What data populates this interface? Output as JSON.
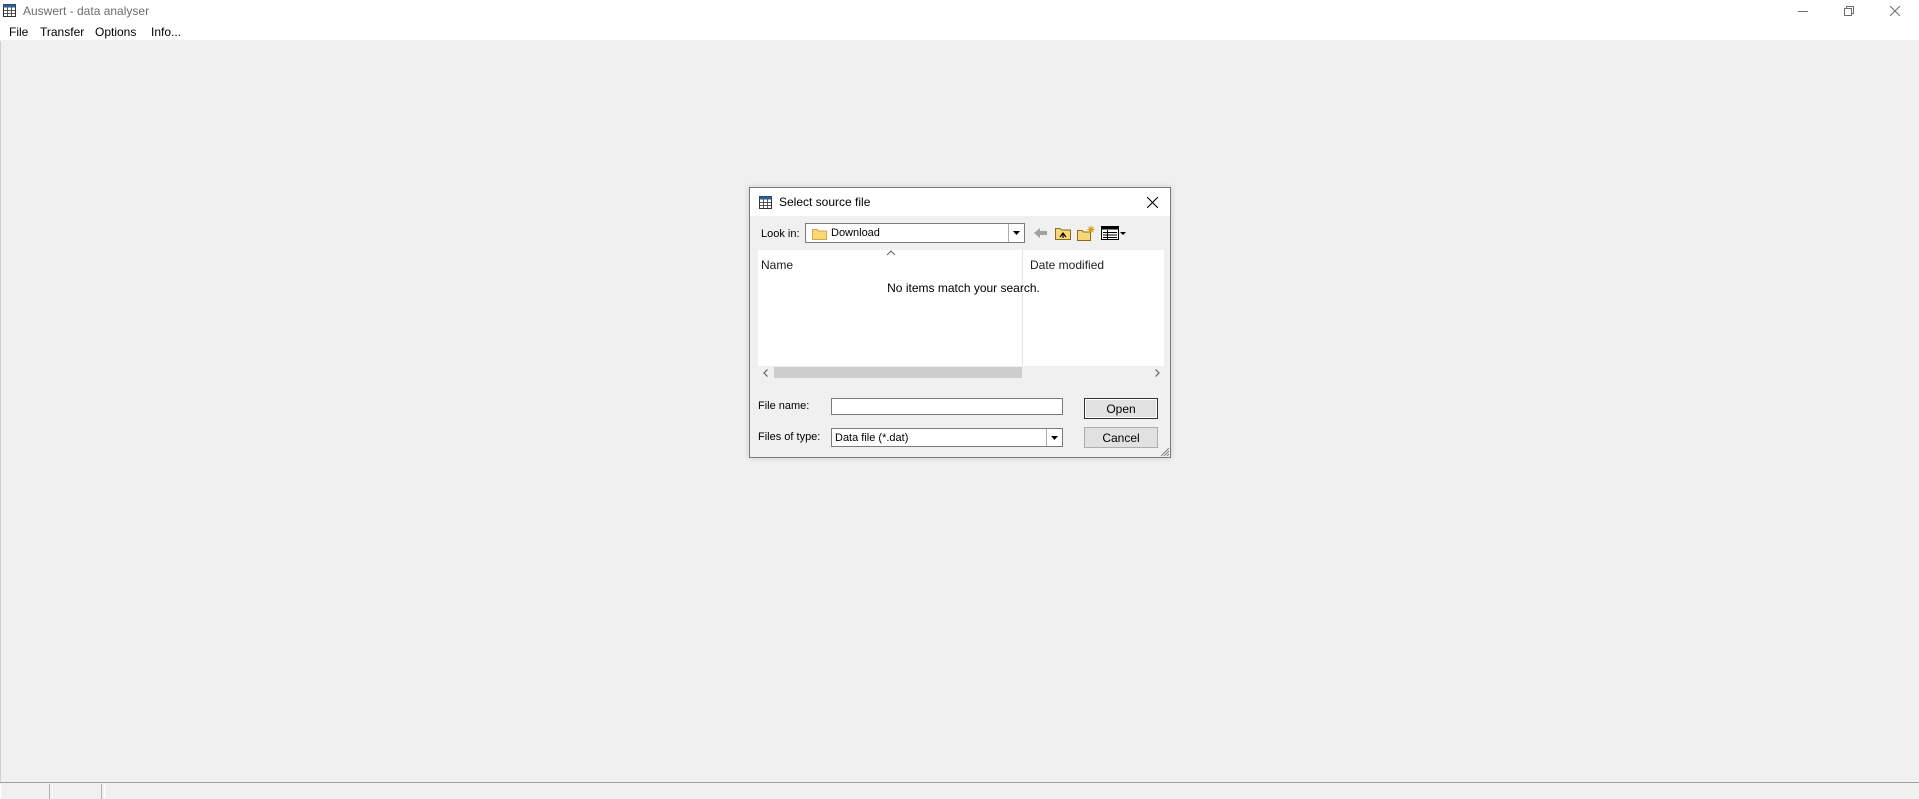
{
  "window": {
    "title": "Auswert - data analyser",
    "icons": {
      "app": "table-grid-icon",
      "minimize": "minimize-icon",
      "restore": "restore-icon",
      "close": "close-icon"
    }
  },
  "menu": {
    "items": [
      "File",
      "Transfer",
      "Options",
      "Info..."
    ]
  },
  "dialog": {
    "title": "Select source file",
    "look_in_label": "Look in:",
    "look_in_value": "Download",
    "columns": {
      "name": "Name",
      "date_modified": "Date modified"
    },
    "empty_message": "No items match your search.",
    "file_name_label": "File name:",
    "file_name_value": "",
    "files_of_type_label": "Files of type:",
    "files_of_type_value": "Data file (*.dat)",
    "open_label": "Open",
    "cancel_label": "Cancel",
    "toolbar_icons": [
      "back-arrow-icon",
      "up-folder-icon",
      "new-folder-icon",
      "view-menu-icon"
    ]
  },
  "colors": {
    "title_text": "#6d6d6d",
    "folder_yellow": "#f8d775",
    "scroll_thumb": "#cdcdcd",
    "button_face": "#e1e1e1"
  }
}
